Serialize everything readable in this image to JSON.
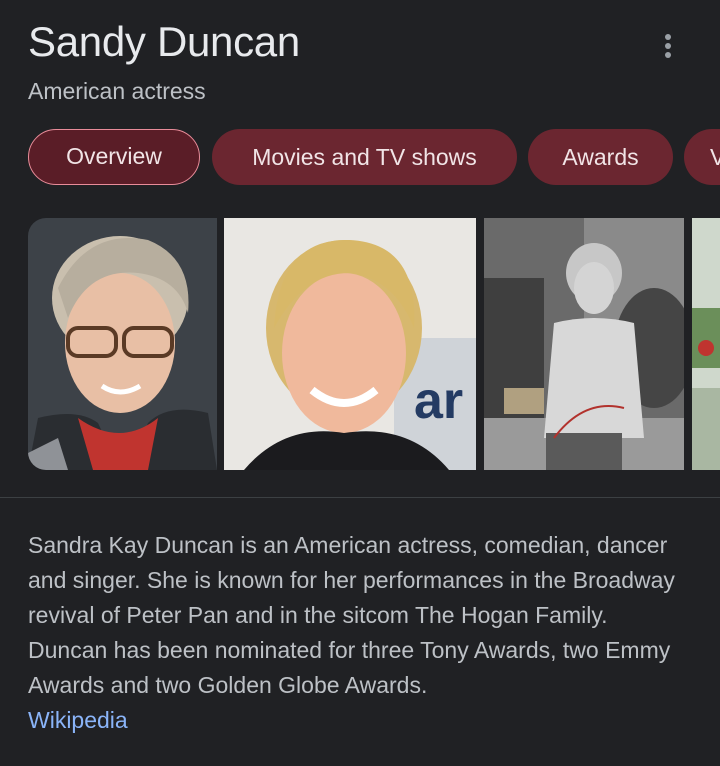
{
  "entity": {
    "name": "Sandy Duncan",
    "type": "American actress"
  },
  "menu_icon": "more-vert-icon",
  "tabs": [
    {
      "label": "Overview",
      "active": true
    },
    {
      "label": "Movies and TV shows",
      "active": false
    },
    {
      "label": "Awards",
      "active": false
    },
    {
      "label": "V",
      "active": false
    }
  ],
  "description": {
    "text": "Sandra Kay Duncan is an American actress, comedian, dancer and singer. She is known for her performances in the Broadway revival of Peter Pan and in the sitcom The Hogan Family. Duncan has been nominated for three Tony Awards, two Emmy Awards and two Golden Globe Awards.",
    "source": "Wikipedia"
  },
  "colors": {
    "background": "#202124",
    "chip": "#6b2630",
    "chip_active_border": "#e88c99",
    "link": "#8ab4f8"
  }
}
